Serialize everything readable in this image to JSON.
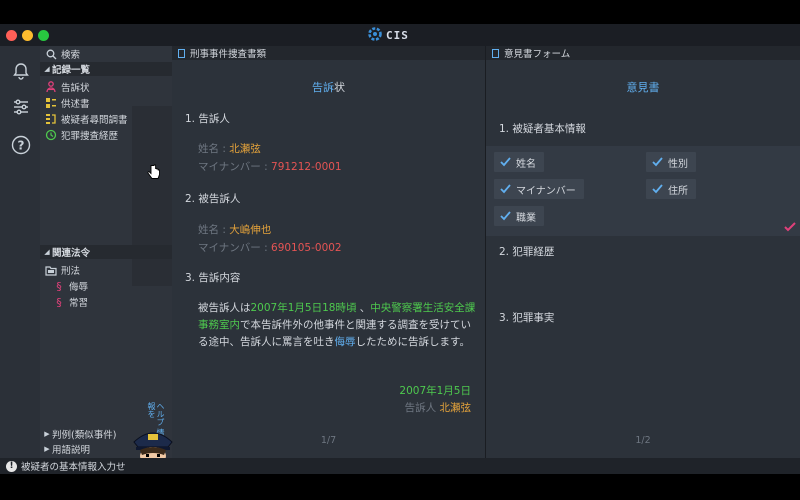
{
  "app": {
    "title": "CIS"
  },
  "sidebar": {
    "search_label": "検索",
    "records_header": "記録一覧",
    "records": [
      {
        "label": "告訴状",
        "icon": "person-icon"
      },
      {
        "label": "供述書",
        "icon": "statement-icon"
      },
      {
        "label": "被疑者尋問調書",
        "icon": "interrogation-icon"
      },
      {
        "label": "犯罪捜査経歴",
        "icon": "history-icon"
      }
    ],
    "laws_header": "関連法令",
    "laws": [
      {
        "label": "刑法",
        "icon": "folder-icon"
      },
      {
        "label": "侮辱",
        "icon": "section-icon"
      },
      {
        "label": "常習",
        "icon": "section-icon"
      }
    ],
    "footer_items": [
      {
        "label": "判例(類似事件)"
      },
      {
        "label": "用語説明"
      }
    ]
  },
  "help_bubble": "ヘルプ 情報を",
  "status": {
    "message": "被疑者の基本情報入力せ"
  },
  "left_panel": {
    "tab_label": "刑事事件捜査書類",
    "doc_title_highlight": "告訴",
    "doc_title_rest": "状",
    "section1": "1. 告訴人",
    "complainant_name_label": "姓名 : ",
    "complainant_name": "北瀬弦",
    "complainant_id_label": "マイナンバー : ",
    "complainant_id": "791212-0001",
    "section2": "2. 被告訴人",
    "accused_name_label": "姓名 : ",
    "accused_name": "大嶋伸也",
    "accused_id_label": "マイナンバー : ",
    "accused_id": "690105-0002",
    "section3": "3. 告訴内容",
    "body": {
      "p1": "被告訴人は",
      "date_time": "2007年1月5日18時頃",
      "p2": " 、",
      "place": "中央警察署生活安全課事務室内",
      "p3": "で本告訴件外の他事件と関連する調査を受けている途中、告訴人に罵言を吐き",
      "insult": "侮辱",
      "p4": "したために告訴します。"
    },
    "sign_date": "2007年1月5日",
    "sign_label": "告訴人 ",
    "sign_name": "北瀬弦",
    "pager": "1/7"
  },
  "right_panel": {
    "tab_label": "意見書フォーム",
    "doc_title": "意見書",
    "section1": "1. 被疑者基本情報",
    "checkboxes": [
      {
        "label": "姓名",
        "checked": true
      },
      {
        "label": "性別",
        "checked": true
      },
      {
        "label": "マイナンバー",
        "checked": true
      },
      {
        "label": "住所",
        "checked": true
      },
      {
        "label": "職業",
        "checked": true
      }
    ],
    "section2": "2. 犯罪経歴",
    "section3": "3. 犯罪事実",
    "pager": "1/2"
  },
  "colors": {
    "accent_blue": "#61afef",
    "name_orange": "#e5a33b",
    "id_red": "#e45454",
    "time_green": "#4ec94e",
    "check_pink": "#e0407a"
  }
}
